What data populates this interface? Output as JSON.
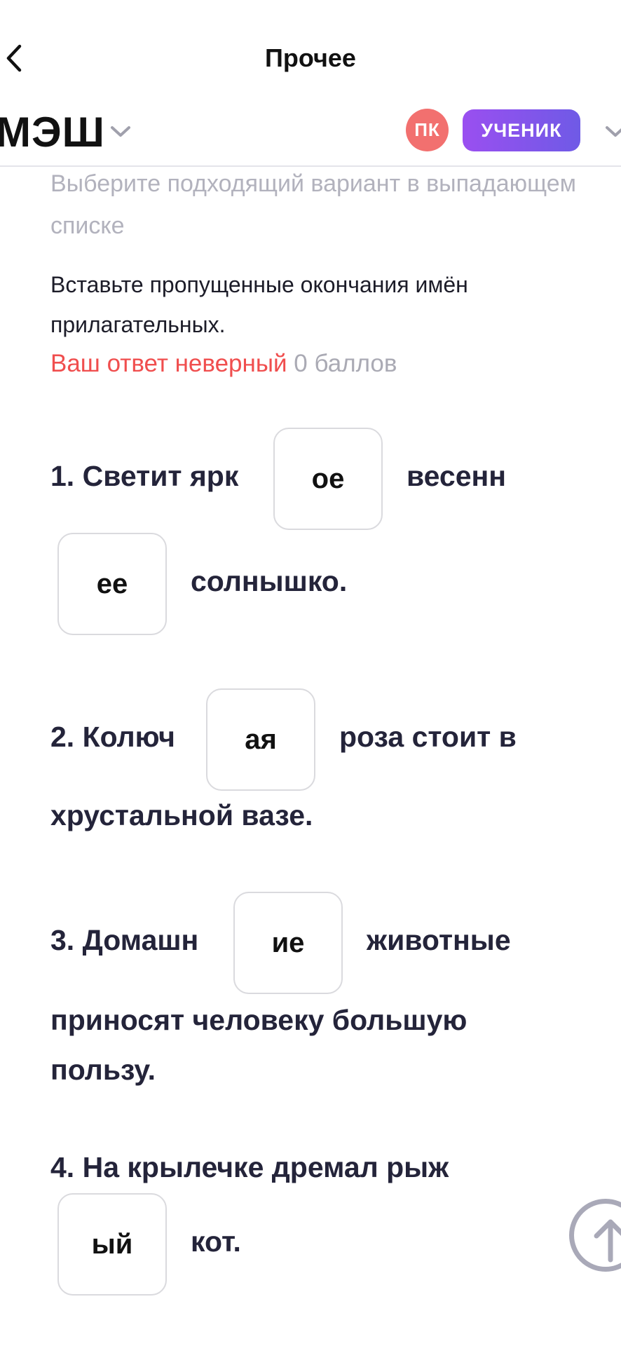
{
  "header": {
    "title": "Прочее"
  },
  "appbar": {
    "logo": "МЭШ",
    "avatar_initials": "ПК",
    "role": "УЧЕНИК"
  },
  "question": {
    "hint": "Выберите подходящий вариант в выпадающем списке",
    "task": "Вставьте пропущенные окончания имён прилагательных.",
    "result_label": "Ваш ответ неверный",
    "score": "0 баллов"
  },
  "items": [
    {
      "before": "1. Светит ярк",
      "answer1": "ое",
      "middle": "весенн",
      "answer2": "ее",
      "after": "солнышко."
    },
    {
      "before": "2. Колюч",
      "answer": "ая",
      "after": "роза стоит в",
      "line2": "хрустальной вазе."
    },
    {
      "before": "3. Домашн",
      "answer": "ие",
      "after": "животные",
      "line2": "приносят человеку большую",
      "line3": "пользу."
    },
    {
      "before": "4. На крылечке дремал рыж",
      "answer": "ый",
      "after": "кот."
    }
  ],
  "icons": {
    "back": "chevron-left-icon",
    "dropdown": "chevron-down-icon",
    "scroll_top": "arrow-up-circle-icon"
  },
  "colors": {
    "error": "#f04e4e",
    "avatar": "#f2706f",
    "badge_start": "#9a4ff0",
    "badge_end": "#6f5ae6"
  }
}
